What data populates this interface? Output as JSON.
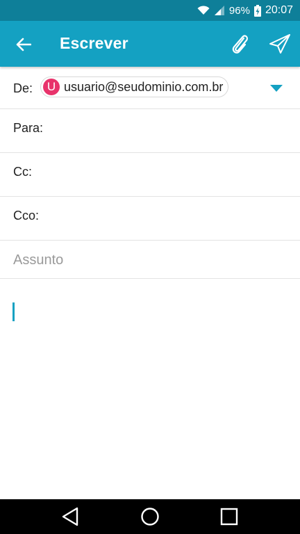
{
  "status_bar": {
    "battery": "96%",
    "time": "20:07",
    "icons": [
      "wifi-icon",
      "signal-icon",
      "battery-charging-icon"
    ]
  },
  "app_bar": {
    "title": "Escrever",
    "icons": [
      "back-arrow-icon",
      "paperclip-icon",
      "send-icon"
    ],
    "background": "#14a1c2"
  },
  "compose": {
    "from_label": "De:",
    "from_avatar_letter": "U",
    "from_email": "usuario@seudominio.com.br",
    "to_label": "Para:",
    "cc_label": "Cc:",
    "bcc_label": "Cco:",
    "subject_placeholder": "Assunto",
    "body_value": ""
  },
  "nav_bar": {
    "icons": [
      "nav-back-icon",
      "nav-home-icon",
      "nav-recent-icon"
    ]
  },
  "colors": {
    "status_bar": "#0e7f99",
    "accent": "#14a1c2",
    "avatar": "#e8336b"
  }
}
